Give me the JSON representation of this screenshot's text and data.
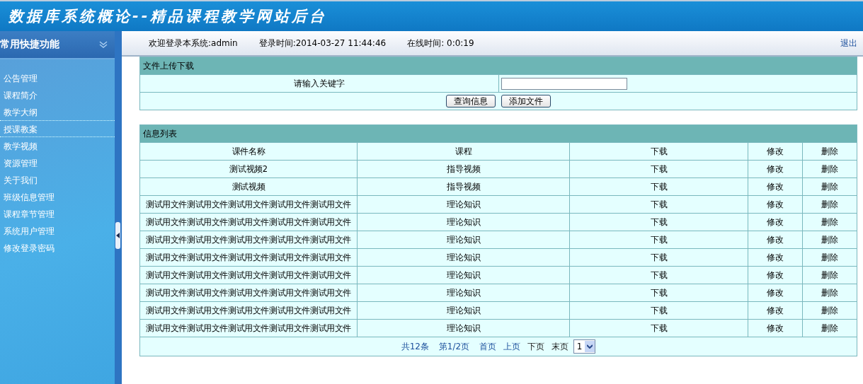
{
  "header": {
    "title": "数据库系统概论--精品课程教学网站后台"
  },
  "sidebar": {
    "title": "常用快捷功能",
    "items": [
      {
        "label": "公告管理",
        "selected": false
      },
      {
        "label": "课程简介",
        "selected": false
      },
      {
        "label": "教学大纲",
        "selected": false
      },
      {
        "label": "授课教案",
        "selected": true
      },
      {
        "label": "教学视频",
        "selected": false
      },
      {
        "label": "资源管理",
        "selected": false
      },
      {
        "label": "关于我们",
        "selected": false
      },
      {
        "label": "班级信息管理",
        "selected": false
      },
      {
        "label": "课程章节管理",
        "selected": false
      },
      {
        "label": "系统用户管理",
        "selected": false
      },
      {
        "label": "修改登录密码",
        "selected": false
      }
    ]
  },
  "top_bar": {
    "welcome": "欢迎登录本系统:admin",
    "login_time": "登录时间:2014-03-27 11:44:46",
    "online_time": "在线时间: 0:0:19",
    "logout": "退出"
  },
  "search_panel": {
    "title": "文件上传下载",
    "label": "请输入关键字",
    "buttons": [
      "查询信息",
      "添加文件"
    ]
  },
  "table": {
    "title": "信息列表",
    "columns": [
      "课件名称",
      "课程",
      "下载",
      "修改",
      "删除"
    ],
    "rows": [
      [
        "测试视频2",
        "指导视频",
        "下载",
        "修改",
        "删除"
      ],
      [
        "测试视频",
        "指导视频",
        "下载",
        "修改",
        "删除"
      ],
      [
        "测试用文件测试用文件测试用文件测试用文件测试用文件",
        "理论知识",
        "下载",
        "修改",
        "删除"
      ],
      [
        "测试用文件测试用文件测试用文件测试用文件测试用文件",
        "理论知识",
        "下载",
        "修改",
        "删除"
      ],
      [
        "测试用文件测试用文件测试用文件测试用文件测试用文件",
        "理论知识",
        "下载",
        "修改",
        "删除"
      ],
      [
        "测试用文件测试用文件测试用文件测试用文件测试用文件",
        "理论知识",
        "下载",
        "修改",
        "删除"
      ],
      [
        "测试用文件测试用文件测试用文件测试用文件测试用文件",
        "理论知识",
        "下载",
        "修改",
        "删除"
      ],
      [
        "测试用文件测试用文件测试用文件测试用文件测试用文件",
        "理论知识",
        "下载",
        "修改",
        "删除"
      ],
      [
        "测试用文件测试用文件测试用文件测试用文件测试用文件",
        "理论知识",
        "下载",
        "修改",
        "删除"
      ],
      [
        "测试用文件测试用文件测试用文件测试用文件测试用文件",
        "理论知识",
        "下载",
        "修改",
        "删除"
      ]
    ]
  },
  "pagination": {
    "total": "共12条",
    "page": "第1/2页",
    "links": [
      {
        "label": "首页",
        "disabled": false
      },
      {
        "label": "上页",
        "disabled": false
      },
      {
        "label": "下页",
        "disabled": true
      },
      {
        "label": "末页",
        "disabled": true
      }
    ],
    "page_select": "1"
  }
}
